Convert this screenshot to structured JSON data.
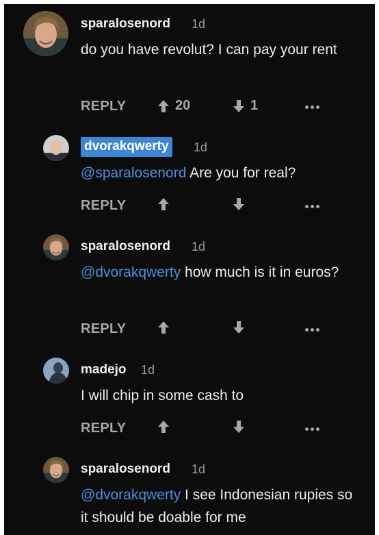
{
  "comments": [
    {
      "username": "sparalosenord",
      "time": "1d",
      "text": "do you have revolut? I can pay your rent",
      "mention": "",
      "reply_label": "REPLY",
      "upvotes": "20",
      "downvotes": "1",
      "avatar_icon": "avatar-man-long-hair"
    },
    {
      "username": "dvorakqwerty",
      "time": "1d",
      "mention": "@sparalosenord",
      "text": " Are you for real?",
      "reply_label": "REPLY",
      "upvotes": "",
      "downvotes": "",
      "avatar_icon": "avatar-man-suit"
    },
    {
      "username": "sparalosenord",
      "time": "1d",
      "mention": "@dvorakqwerty",
      "text": " how much is it in euros?",
      "reply_label": "REPLY",
      "upvotes": "",
      "downvotes": "",
      "avatar_icon": "avatar-man-long-hair"
    },
    {
      "username": "madejo",
      "time": "1d",
      "mention": "",
      "text": "I will chip in some cash to",
      "reply_label": "REPLY",
      "upvotes": "",
      "downvotes": "",
      "avatar_icon": "avatar-dark-figure"
    },
    {
      "username": "sparalosenord",
      "time": "1d",
      "mention": "@dvorakqwerty",
      "text": " I see Indonesian rupies so it should be doable for me",
      "avatar_icon": "avatar-man-long-hair"
    }
  ],
  "colors": {
    "background": "#0c0c0d",
    "mention": "#4f8ee0",
    "highlight": "#3d86d6",
    "muted": "#a8a8a8"
  }
}
